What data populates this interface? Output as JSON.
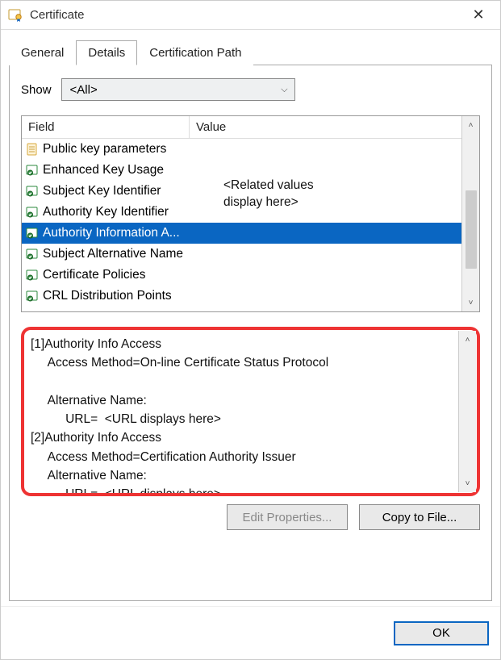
{
  "window": {
    "title": "Certificate",
    "close_glyph": "✕"
  },
  "tabs": {
    "general": "General",
    "details": "Details",
    "certpath": "Certification Path",
    "active": "details"
  },
  "show": {
    "label": "Show",
    "value": "<All>",
    "chevron": "⌵"
  },
  "fields": {
    "header_field": "Field",
    "header_value": "Value",
    "value_placeholder_line1": "<Related values",
    "value_placeholder_line2": "display here>",
    "rows": [
      {
        "icon": "page",
        "label": "Public key parameters",
        "selected": false
      },
      {
        "icon": "ext",
        "label": "Enhanced Key Usage",
        "selected": false
      },
      {
        "icon": "ext",
        "label": "Subject Key Identifier",
        "selected": false
      },
      {
        "icon": "ext",
        "label": "Authority Key Identifier",
        "selected": false
      },
      {
        "icon": "ext",
        "label": "Authority Information A...",
        "selected": true
      },
      {
        "icon": "ext",
        "label": "Subject Alternative Name",
        "selected": false
      },
      {
        "icon": "ext",
        "label": "Certificate Policies",
        "selected": false
      },
      {
        "icon": "ext",
        "label": "CRL Distribution Points",
        "selected": false
      }
    ],
    "scroll_up": "˄",
    "scroll_down": "˅"
  },
  "detail": {
    "l1": "[1]Authority Info Access",
    "l2": "     Access Method=On-line Certificate Status Protocol",
    "l3": "",
    "l4": "     Alternative Name:",
    "l5": "          URL=  <URL displays here>",
    "l6": "[2]Authority Info Access",
    "l7": "     Access Method=Certification Authority Issuer",
    "l8": "     Alternative Name:",
    "l9": "          URL=  <URL displays here>"
  },
  "buttons": {
    "edit_properties": "Edit Properties...",
    "copy_to_file": "Copy to File...",
    "ok": "OK"
  }
}
